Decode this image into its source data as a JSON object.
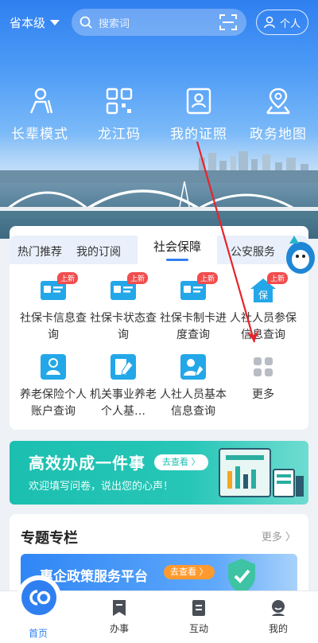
{
  "header": {
    "region": "省本级",
    "search_placeholder": "搜索词",
    "personal_label": "个人"
  },
  "quick_links": [
    {
      "label": "长辈模式",
      "icon": "elder-icon"
    },
    {
      "label": "龙江码",
      "icon": "qrcode-icon"
    },
    {
      "label": "我的证照",
      "icon": "id-card-icon"
    },
    {
      "label": "政务地图",
      "icon": "map-icon"
    }
  ],
  "tabs": {
    "hot": "热门推荐",
    "subscribe": "我的订阅",
    "social": "社会保障",
    "police": "公安服务"
  },
  "services": [
    {
      "label": "社保卡信息查询",
      "badge": "上新",
      "icon": "card-icon"
    },
    {
      "label": "社保卡状态查询",
      "badge": "上新",
      "icon": "card-status-icon"
    },
    {
      "label": "社保卡制卡进度查询",
      "badge": "上新",
      "icon": "card-progress-icon"
    },
    {
      "label": "人社人员参保信息查询",
      "badge": "上新",
      "icon": "insurance-home-icon"
    },
    {
      "label": "养老保险个人账户查询",
      "icon": "pension-icon"
    },
    {
      "label": "机关事业养老个人基…",
      "icon": "edit-doc-icon"
    },
    {
      "label": "人社人员基本信息查询",
      "icon": "person-edit-icon"
    },
    {
      "label": "更多",
      "icon": "more-grid-icon"
    }
  ],
  "banner": {
    "title": "高效办成一件事",
    "go": "去查看 〉",
    "subtitle": "欢迎填写问卷，说出您的心声！"
  },
  "topics": {
    "title": "专题专栏",
    "more": "更多 〉",
    "card_title": "惠企政策服务平台",
    "card_go": "去查看 〉"
  },
  "tabbar": {
    "home": "首页",
    "affairs": "办事",
    "interact": "互动",
    "mine": "我的"
  },
  "colors": {
    "primary": "#2f7ff0",
    "badge": "#f04e4e",
    "banner": "#1bbfb0",
    "arrow": "#e8232a"
  }
}
